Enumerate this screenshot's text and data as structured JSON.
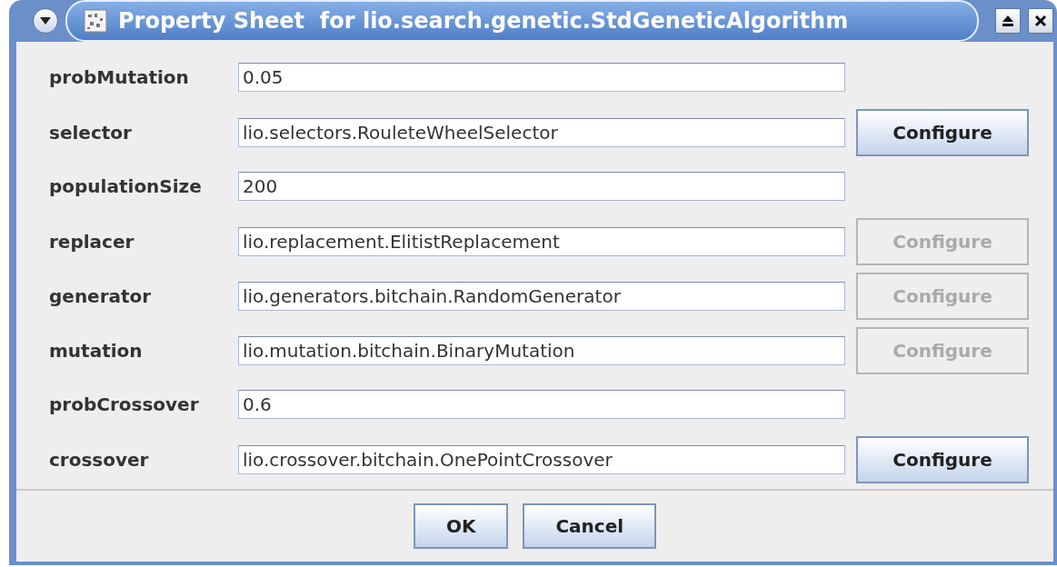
{
  "window": {
    "title": "Property Sheet  for lio.search.genetic.StdGeneticAlgorithm"
  },
  "properties": [
    {
      "label": "probMutation",
      "value": "0.05"
    },
    {
      "label": "selector",
      "value": "lio.selectors.RouleteWheelSelector",
      "button": {
        "label": "Configure",
        "disabled": false
      }
    },
    {
      "label": "populationSize",
      "value": "200"
    },
    {
      "label": "replacer",
      "value": "lio.replacement.ElitistReplacement",
      "button": {
        "label": "Configure",
        "disabled": true
      }
    },
    {
      "label": "generator",
      "value": "lio.generators.bitchain.RandomGenerator",
      "button": {
        "label": "Configure",
        "disabled": true
      }
    },
    {
      "label": "mutation",
      "value": "lio.mutation.bitchain.BinaryMutation",
      "button": {
        "label": "Configure",
        "disabled": true
      }
    },
    {
      "label": "probCrossover",
      "value": "0.6"
    },
    {
      "label": "crossover",
      "value": "lio.crossover.bitchain.OnePointCrossover",
      "button": {
        "label": "Configure",
        "disabled": false
      }
    }
  ],
  "buttons": [
    "OK",
    "Cancel"
  ]
}
